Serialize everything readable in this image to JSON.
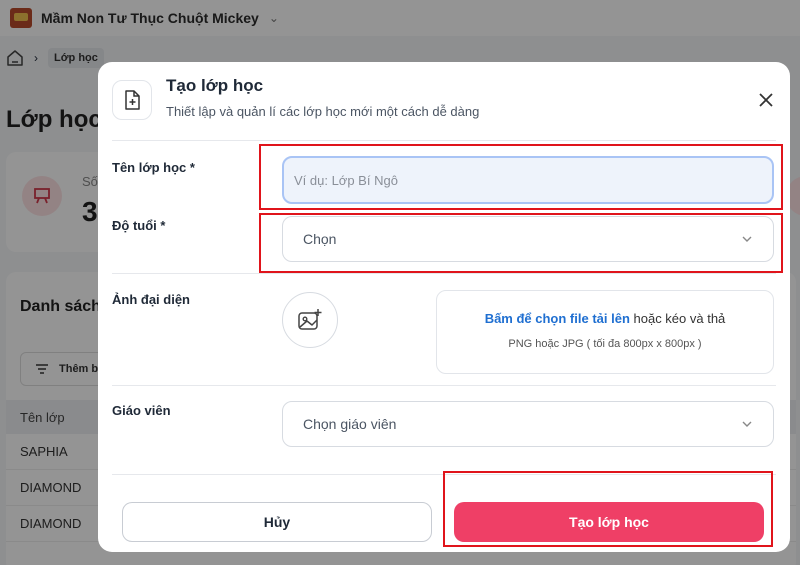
{
  "app": {
    "school_name": "Mầm Non Tư Thục Chuột Mickey",
    "breadcrumb_current": "Lớp học",
    "page_title": "Lớp học",
    "stat": {
      "label": "Số",
      "value": "3"
    },
    "list_title": "Danh sách",
    "filter_label": "Thêm b",
    "table_header": "Tên lớp",
    "rows": [
      "SAPHIA",
      "DIAMOND",
      "DIAMOND"
    ]
  },
  "modal": {
    "title": "Tạo lớp học",
    "subtitle": "Thiết lập và quản lí các lớp học mới một cách dễ dàng",
    "fields": {
      "class_name_label": "Tên lớp học *",
      "class_name_placeholder": "Ví dụ: Lớp Bí Ngô",
      "class_name_value": "",
      "age_label": "Độ tuổi *",
      "age_value": "Chọn",
      "avatar_label": "Ảnh đại diện",
      "upload_link": "Bấm để chọn file tải lên",
      "upload_rest": " hoặc kéo và thả",
      "upload_hint": "PNG hoặc JPG ( tối đa 800px x 800px )",
      "teacher_label": "Giáo viên",
      "teacher_value": "Chọn giáo viên"
    },
    "buttons": {
      "cancel": "Hủy",
      "create": "Tạo lớp học"
    }
  },
  "colors": {
    "primary": "#ef3f66",
    "link": "#1f6fd1",
    "highlight": "#e0141b",
    "overlay": "rgba(0,0,0,0.42)"
  },
  "icons": [
    "school-logo-icon",
    "chevron-down-icon",
    "home-icon",
    "presentation-icon",
    "filter-icon",
    "file-plus-icon",
    "close-icon",
    "image-plus-icon"
  ]
}
